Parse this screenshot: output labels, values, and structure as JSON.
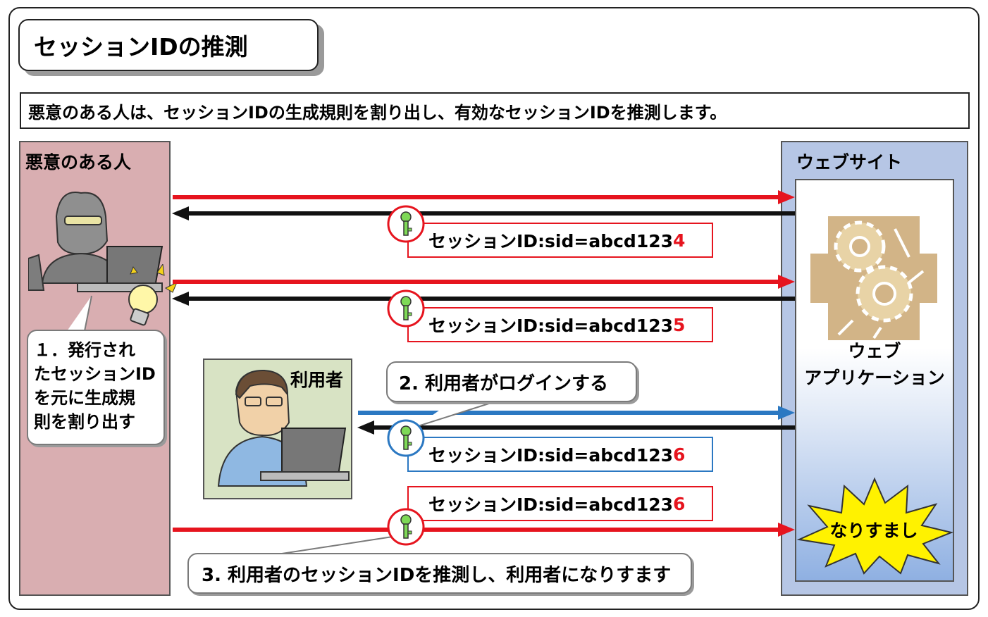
{
  "title": "セッションIDの推測",
  "description": "悪意のある人は、セッションIDの生成規則を割り出し、有効なセッションIDを推測します。",
  "attacker": {
    "label": "悪意のある人"
  },
  "website": {
    "label": "ウェブサイト",
    "app_label_line1": "ウェブ",
    "app_label_line2": "アプリケーション"
  },
  "user": {
    "label": "利用者"
  },
  "steps": {
    "step1_lines": [
      "１．発行され",
      "たセッションID",
      "を元に生成規",
      "則を割り出す"
    ],
    "step2": "2. 利用者がログインする",
    "step3": "3. 利用者のセッションIDを推測し、利用者になりすます"
  },
  "sessions": [
    {
      "prefix": "セッションID:sid=abcd123",
      "suffix": "4"
    },
    {
      "prefix": "セッションID:sid=abcd123",
      "suffix": "5"
    },
    {
      "prefix": "セッションID:sid=abcd123",
      "suffix": "6"
    },
    {
      "prefix": "セッションID:sid=abcd123",
      "suffix": "6"
    }
  ],
  "spoof_label": "なりすまし",
  "colors": {
    "request_red": "#e6141e",
    "response_black": "#111111",
    "user_blue": "#2b78c2"
  }
}
